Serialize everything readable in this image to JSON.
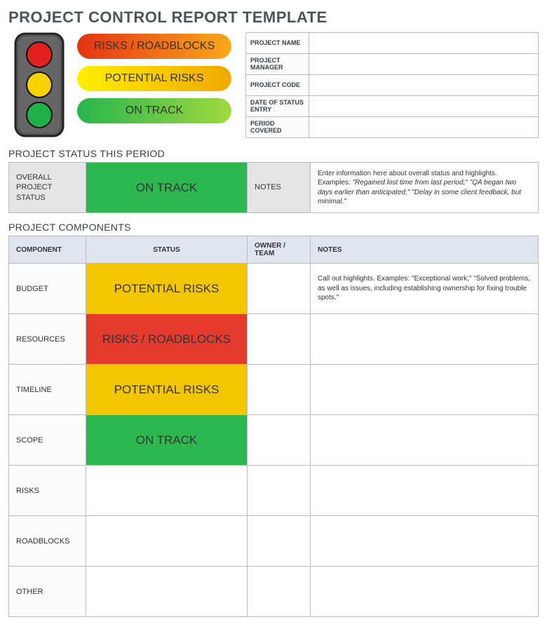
{
  "title": "PROJECT CONTROL REPORT TEMPLATE",
  "legend": {
    "red": "RISKS / ROADBLOCKS",
    "yellow": "POTENTIAL RISKS",
    "green": "ON TRACK"
  },
  "meta": [
    {
      "label": "PROJECT NAME",
      "value": ""
    },
    {
      "label": "PROJECT MANAGER",
      "value": ""
    },
    {
      "label": "PROJECT CODE",
      "value": ""
    },
    {
      "label": "DATE OF STATUS ENTRY",
      "value": ""
    },
    {
      "label": "PERIOD COVERED",
      "value": ""
    }
  ],
  "status_section": {
    "heading": "PROJECT STATUS THIS PERIOD",
    "overall_label": "OVERALL PROJECT STATUS",
    "overall_status": "ON TRACK",
    "overall_status_class": "badge-green",
    "notes_label": "NOTES",
    "notes_lead": "Enter information here about overall status and highlights. Examples: ",
    "notes_examples": "\"Regained lost time from last period;\" \"QA began two days earlier than anticipated;\" \"Delay in some client feedback, but minimal.\""
  },
  "components_section": {
    "heading": "PROJECT COMPONENTS",
    "headers": {
      "component": "COMPONENT",
      "status": "STATUS",
      "owner": "OWNER / TEAM",
      "notes": "NOTES"
    },
    "rows": [
      {
        "component": "BUDGET",
        "status": "POTENTIAL RISKS",
        "status_class": "badge-yellow",
        "owner": "",
        "notes": "Call out highlights. Examples: \"Exceptional work,\" \"Solved problems, as well as issues, including establishing ownership for fixing trouble spots.\""
      },
      {
        "component": "RESOURCES",
        "status": "RISKS / ROADBLOCKS",
        "status_class": "badge-red",
        "owner": "",
        "notes": ""
      },
      {
        "component": "TIMELINE",
        "status": "POTENTIAL RISKS",
        "status_class": "badge-yellow",
        "owner": "",
        "notes": ""
      },
      {
        "component": "SCOPE",
        "status": "ON TRACK",
        "status_class": "badge-green",
        "owner": "",
        "notes": ""
      },
      {
        "component": "RISKS",
        "status": "",
        "status_class": "",
        "owner": "",
        "notes": ""
      },
      {
        "component": "ROADBLOCKS",
        "status": "",
        "status_class": "",
        "owner": "",
        "notes": ""
      },
      {
        "component": "OTHER",
        "status": "",
        "status_class": "",
        "owner": "",
        "notes": ""
      }
    ]
  }
}
